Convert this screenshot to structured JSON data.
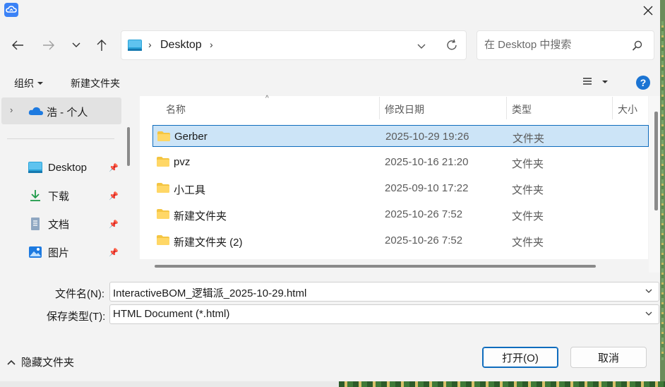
{
  "nav": {
    "address_segment": "Desktop",
    "search_placeholder": "在 Desktop 中搜索"
  },
  "toolbar": {
    "organize_label": "组织",
    "new_folder_label": "新建文件夹"
  },
  "sidebar": {
    "onedrive_label": "浩 - 个人",
    "items": [
      {
        "label": "Desktop",
        "icon": "desktop-icon"
      },
      {
        "label": "下载",
        "icon": "download-icon"
      },
      {
        "label": "文档",
        "icon": "documents-icon"
      },
      {
        "label": "图片",
        "icon": "pictures-icon"
      }
    ]
  },
  "columns": {
    "name": "名称",
    "date": "修改日期",
    "type": "类型",
    "size": "大小"
  },
  "files": [
    {
      "name": "Gerber",
      "date": "2025-10-29 19:26",
      "type": "文件夹",
      "selected": true
    },
    {
      "name": "pvz",
      "date": "2025-10-16 21:20",
      "type": "文件夹"
    },
    {
      "name": "小工具",
      "date": "2025-09-10 17:22",
      "type": "文件夹"
    },
    {
      "name": "新建文件夹",
      "date": "2025-10-26 7:52",
      "type": "文件夹"
    },
    {
      "name": "新建文件夹 (2)",
      "date": "2025-10-26 7:52",
      "type": "文件夹"
    }
  ],
  "form": {
    "filename_label": "文件名(N):",
    "filename_value": "InteractiveBOM_逻辑派_2025-10-29.html",
    "filetype_label": "保存类型(T):",
    "filetype_value": "HTML Document (*.html)"
  },
  "footer": {
    "hide_folders_label": "隐藏文件夹",
    "open_label": "打开(O)",
    "cancel_label": "取消"
  },
  "colors": {
    "accent": "#0f6cbd",
    "selection": "#cce4f7",
    "folder": "#f4c542"
  }
}
